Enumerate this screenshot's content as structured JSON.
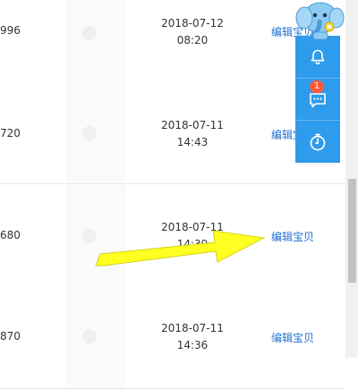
{
  "rows": [
    {
      "num": "996",
      "date": "2018-07-12",
      "time": "08:20",
      "action": "编辑宝贝"
    },
    {
      "num": "720",
      "date": "2018-07-11",
      "time": "14:43",
      "action": "编辑宝"
    },
    {
      "num": "680",
      "date": "2018-07-11",
      "time": "14:39",
      "action": "编辑宝贝"
    },
    {
      "num": "870",
      "date": "2018-07-11",
      "time": "14:36",
      "action": "编辑宝贝"
    }
  ],
  "float_bar": {
    "notify_badge": "1",
    "accent": "#2e9bec"
  },
  "link_color": "#1d6fd1",
  "arrow_color": "#ffff22",
  "icons": [
    "bell-icon",
    "message-icon",
    "timer-icon",
    "elephant-mascot-icon"
  ]
}
